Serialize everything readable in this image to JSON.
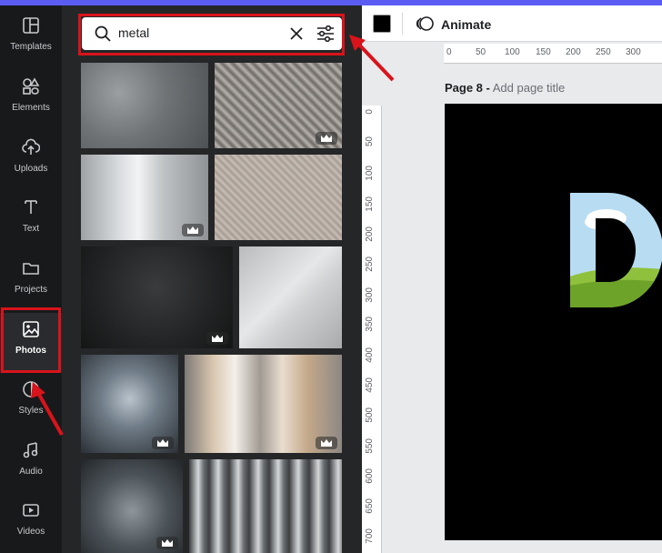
{
  "rail": {
    "items": [
      {
        "label": "Templates",
        "icon": "templates-icon"
      },
      {
        "label": "Elements",
        "icon": "elements-icon"
      },
      {
        "label": "Uploads",
        "icon": "uploads-icon"
      },
      {
        "label": "Text",
        "icon": "text-icon"
      },
      {
        "label": "Projects",
        "icon": "projects-icon"
      },
      {
        "label": "Photos",
        "icon": "photos-icon",
        "active": true
      },
      {
        "label": "Styles",
        "icon": "styles-icon"
      },
      {
        "label": "Audio",
        "icon": "audio-icon"
      },
      {
        "label": "Videos",
        "icon": "videos-icon"
      }
    ]
  },
  "search": {
    "value": "metal"
  },
  "toolbar": {
    "animate_label": "Animate",
    "color": "#000000"
  },
  "page": {
    "title": "Page 8 -",
    "placeholder": "Add page title"
  },
  "ruler": {
    "top": [
      "0",
      "50",
      "100",
      "150",
      "200",
      "250",
      "300"
    ],
    "left": [
      "0",
      "50",
      "100",
      "150",
      "200",
      "250",
      "300",
      "350",
      "400",
      "450",
      "500",
      "550",
      "600",
      "650",
      "700"
    ]
  },
  "colors": {
    "accent": "#5b5df2",
    "highlight": "#d9131b",
    "rail": "#18191b",
    "panel": "#252627"
  },
  "photos": {
    "premium_icon": "crown-icon"
  }
}
